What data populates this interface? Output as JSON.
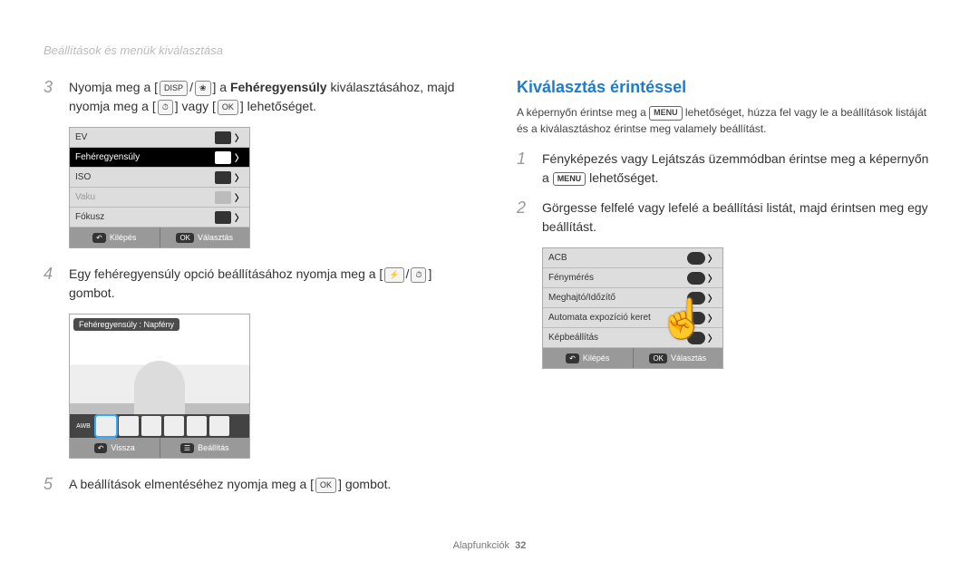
{
  "header": {
    "breadcrumb": "Beállítások és menük kiválasztása"
  },
  "left": {
    "step3": {
      "num": "3",
      "text_pre": "Nyomja meg a [",
      "icon1": "DISP",
      "icon2": "❀",
      "text_mid": "] a ",
      "bold": "Fehéregyensúly",
      "text_after_bold": " kiválasztásához, majd nyomja meg a [",
      "icon3": "⏱",
      "text_or": "] vagy [",
      "icon4": "OK",
      "text_end": "] lehetőséget."
    },
    "menu1": {
      "rows": [
        {
          "label": "EV",
          "selected": false,
          "dim": false
        },
        {
          "label": "Fehéregyensúly",
          "selected": true,
          "dim": false
        },
        {
          "label": "ISO",
          "selected": false,
          "dim": false
        },
        {
          "label": "Vaku",
          "selected": false,
          "dim": true
        },
        {
          "label": "Fókusz",
          "selected": false,
          "dim": false
        }
      ],
      "footer": {
        "left_key": "↶",
        "left": "Kilépés",
        "right_key": "OK",
        "right": "Választás"
      }
    },
    "step4": {
      "num": "4",
      "text_pre": "Egy fehéregyensúly opció beállításához nyomja meg a [",
      "icon1": "⚡",
      "icon_sep": "/",
      "icon2": "⏱",
      "text_end": "] gombot."
    },
    "preview": {
      "title": "Fehéregyensúly : Napfény",
      "strip_awb": "AWB",
      "footer": {
        "left_key": "↶",
        "left": "Vissza",
        "right_key": "☰",
        "right": "Beállítás"
      }
    },
    "step5": {
      "num": "5",
      "text_pre": "A beállítások elmentéséhez nyomja meg a [",
      "icon1": "OK",
      "text_end": "] gombot."
    }
  },
  "right": {
    "title": "Kiválasztás érintéssel",
    "desc_pre": "A képernyőn érintse meg a ",
    "menu_word": "MENU",
    "desc_post": " lehetőséget, húzza fel vagy le a beállítások listáját és a kiválasztáshoz érintse meg valamely beállítást.",
    "step1": {
      "num": "1",
      "text_pre": "Fényképezés vagy Lejátszás üzemmódban érintse meg a képernyőn a ",
      "menu_word": "MENU",
      "text_end": " lehetőséget."
    },
    "step2": {
      "num": "2",
      "text": "Görgesse felfelé vagy lefelé a beállítási listát, majd érintsen meg egy beállítást."
    },
    "menu2": {
      "rows": [
        {
          "label": "ACB"
        },
        {
          "label": "Fénymérés"
        },
        {
          "label": "Meghajtó/Időzítő"
        },
        {
          "label": "Automata expozíció keret"
        },
        {
          "label": "Képbeállítás"
        }
      ],
      "footer": {
        "left_key": "↶",
        "left": "Kilépés",
        "right_key": "OK",
        "right": "Választás"
      }
    }
  },
  "footer": {
    "section": "Alapfunkciók",
    "page": "32"
  }
}
